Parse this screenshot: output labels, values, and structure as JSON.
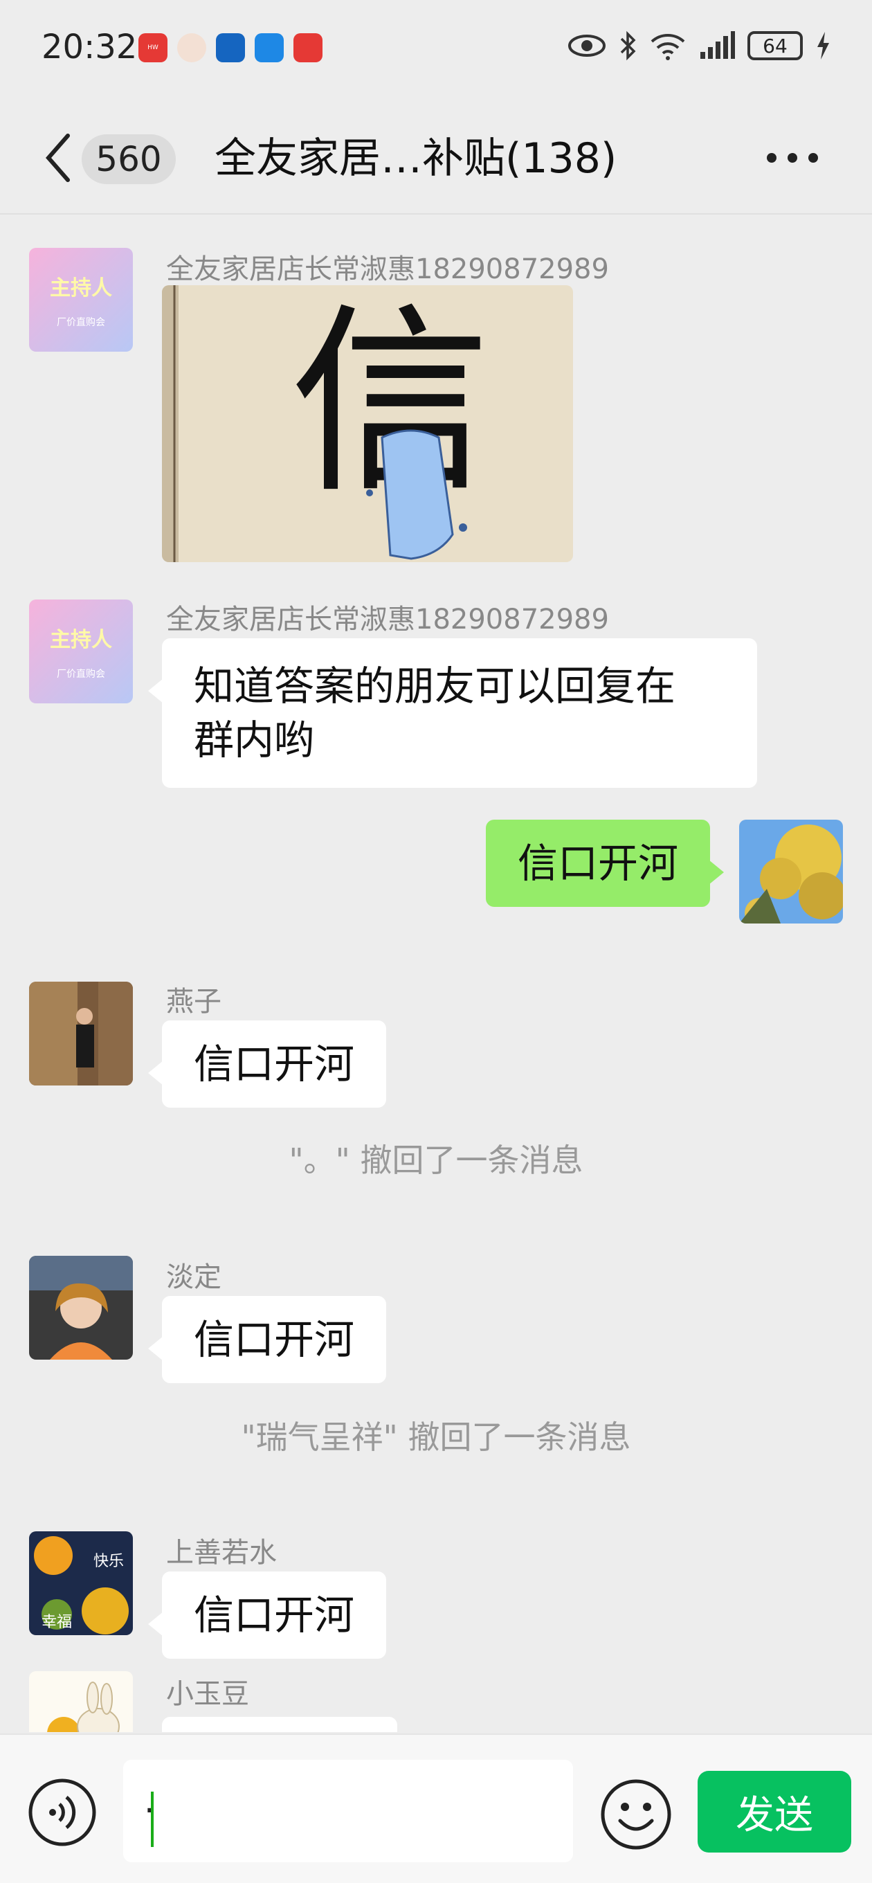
{
  "status_bar": {
    "time": "20:32",
    "battery": "64",
    "app_icons": [
      "huawei-icon",
      "avatar-app-icon",
      "browser-icon",
      "message-icon",
      "red-app-icon"
    ]
  },
  "nav": {
    "back_count": "560",
    "title": "全友家居…补贴(138)"
  },
  "messages": [
    {
      "type": "image",
      "sender": "全友家居店长常淑惠18290872989",
      "avatar_text": "主持人",
      "avatar_subtext": "厂价直购会",
      "image_char": "信"
    },
    {
      "type": "text",
      "sender": "全友家居店长常淑惠18290872989",
      "avatar_text": "主持人",
      "avatar_subtext": "厂价直购会",
      "text_line1": "知道答案的朋友可以回复在",
      "text_line2": "群内哟"
    },
    {
      "type": "mine",
      "text": "信口开河"
    },
    {
      "type": "text",
      "sender": "燕子",
      "text": "信口开河"
    },
    {
      "type": "system",
      "text": "\"。\" 撤回了一条消息"
    },
    {
      "type": "text",
      "sender": "淡定",
      "text": "信口开河"
    },
    {
      "type": "system",
      "text": "\"瑞气呈祥\" 撤回了一条消息"
    },
    {
      "type": "text",
      "sender": "上善若水",
      "text": "信口开河",
      "avatar_text1": "快乐",
      "avatar_text2": "幸福"
    },
    {
      "type": "text",
      "sender": "小玉豆",
      "text": ""
    }
  ],
  "input_bar": {
    "value": ".",
    "send_label": "发送"
  },
  "colors": {
    "accent": "#07c160",
    "mine_bubble": "#95ec69",
    "background": "#ededed"
  }
}
